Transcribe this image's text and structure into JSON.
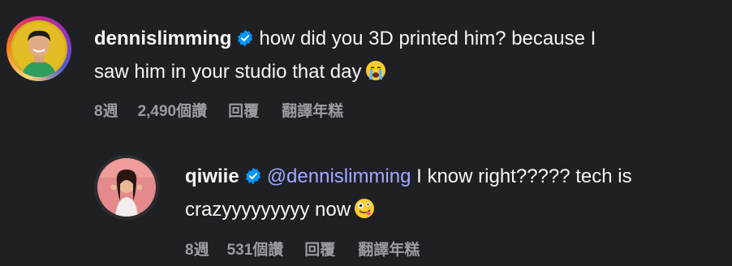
{
  "comments": [
    {
      "username": "dennislimming",
      "text": "how did you 3D printed him? because I saw him in your studio that day",
      "line1": "how did you 3D printed him? because I",
      "line2": "saw him in your studio that day",
      "emoji": "loudly-crying-face",
      "time": "8週",
      "likes": "2,490個讚",
      "reply": "回覆",
      "translate": "翻譯年糕"
    },
    {
      "username": "qiwiie",
      "mention": "@dennislimming",
      "text_after_mention": "I know right????? tech is",
      "line2": "crazyyyyyyyyy now",
      "emoji": "zany-face",
      "time": "8週",
      "likes": "531個讚",
      "reply": "回覆",
      "translate": "翻譯年糕"
    }
  ],
  "colors": {
    "background": "#1f2024",
    "text": "#f5f5f5",
    "meta": "#9b9ca1",
    "mention": "#a3a8ff",
    "verified": "#0095f6"
  }
}
